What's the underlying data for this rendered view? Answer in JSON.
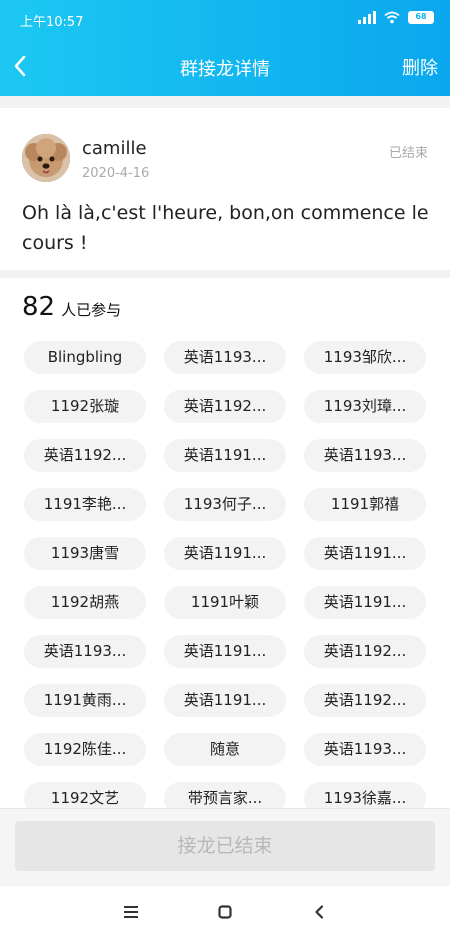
{
  "status_bar": {
    "time": "上午10:57",
    "battery": "68"
  },
  "header": {
    "title": "群接龙详情",
    "delete_label": "删除"
  },
  "post": {
    "username": "camille",
    "date": "2020-4-16",
    "status": "已结束",
    "content": "Oh là là,c'est l'heure, bon,on commence le cours !"
  },
  "participants": {
    "count": "82",
    "count_suffix": "人已参与",
    "tags": [
      "Blingbling",
      "英语1193...",
      "1193邹欣...",
      "1192张璇",
      "英语1192...",
      "1193刘璋...",
      "英语1192...",
      "英语1191...",
      "英语1193...",
      "1191李艳...",
      "1193何子...",
      "1191郭禧",
      "1193唐雪",
      "英语1191...",
      "英语1191...",
      "1192胡燕",
      "1191叶颖",
      "英语1191...",
      "英语1193...",
      "英语1191...",
      "英语1192...",
      "1191黄雨...",
      "英语1191...",
      "英语1192...",
      "1192陈佳...",
      "随意",
      "英语1193...",
      "1192文艺",
      "带预言家...",
      "1193徐嘉..."
    ]
  },
  "footer": {
    "end_button_label": "接龙已结束"
  },
  "nav": {
    "icons": [
      "menu-icon",
      "home-icon",
      "back-icon"
    ]
  }
}
